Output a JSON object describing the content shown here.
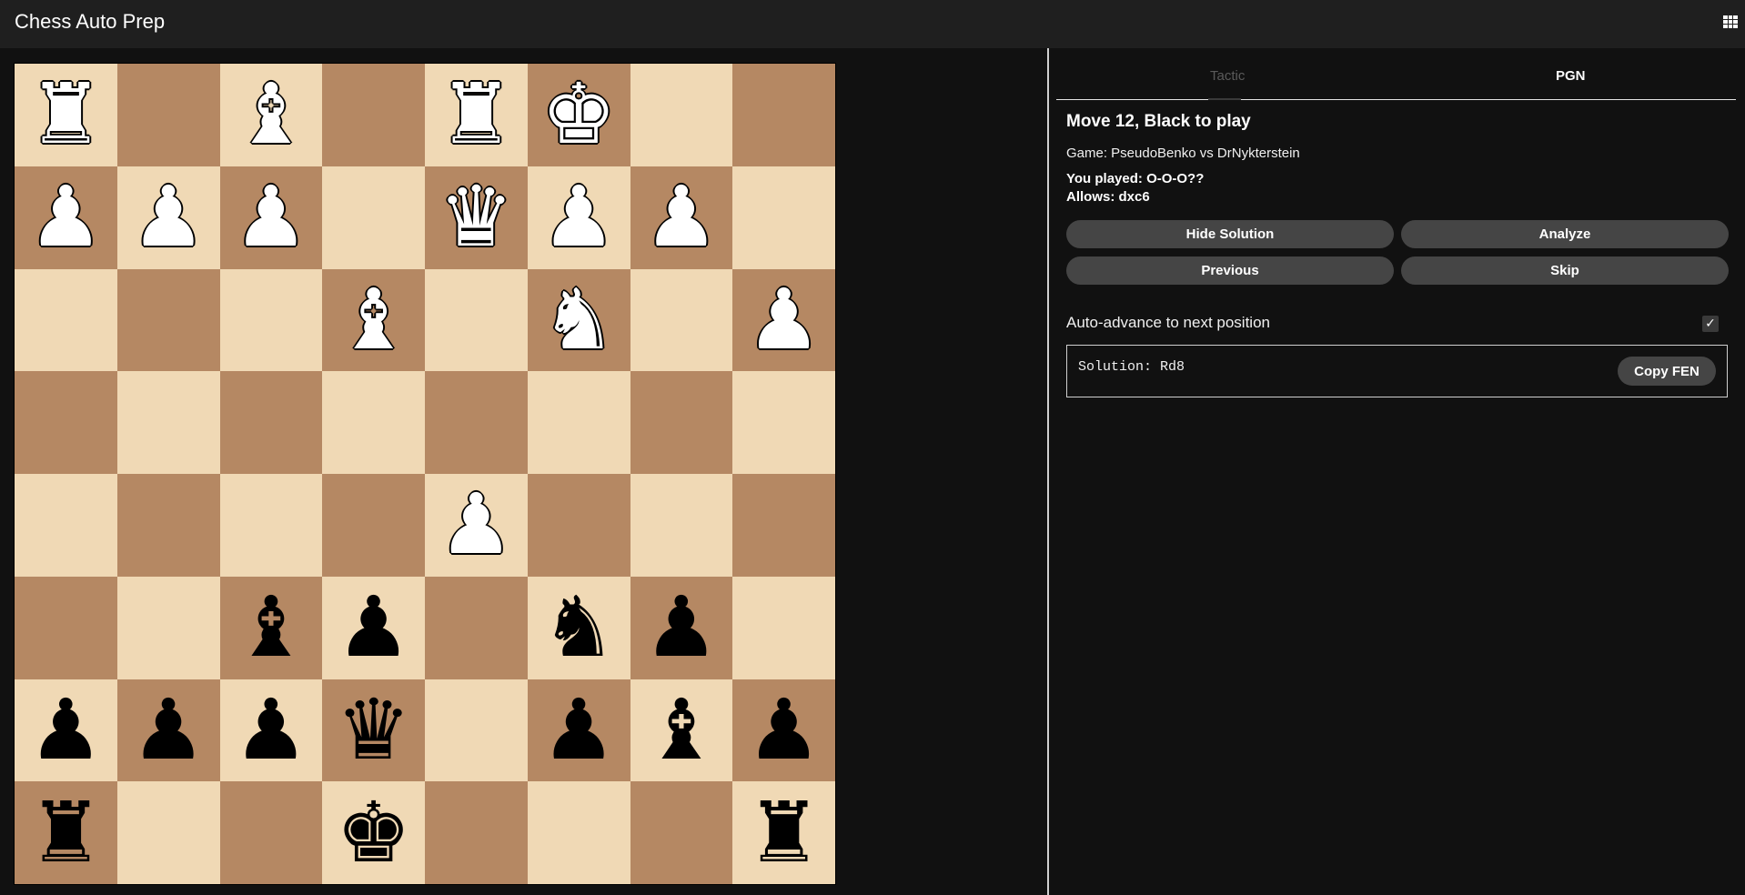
{
  "header": {
    "title": "Chess Auto Prep",
    "menu_icon": "grid-icon"
  },
  "board": {
    "light_color": "#f0d9b5",
    "dark_color": "#b58863",
    "rows": [
      [
        "♜",
        "",
        "♝",
        "",
        "♜",
        "♚",
        "",
        ""
      ],
      [
        "♟",
        "♟",
        "♟",
        "",
        "♛",
        "♟",
        "♟",
        ""
      ],
      [
        "",
        "",
        "",
        "♝",
        "",
        "♞",
        "",
        "♟"
      ],
      [
        "",
        "",
        "",
        "",
        "",
        "",
        "",
        ""
      ],
      [
        "",
        "",
        "",
        "",
        "♟",
        "",
        "",
        ""
      ],
      [
        "",
        "",
        "♝",
        "♟",
        "",
        "♞",
        "♟",
        ""
      ],
      [
        "♟",
        "♟",
        "♟",
        "♛",
        "",
        "♟",
        "♝",
        "♟"
      ],
      [
        "♜",
        "",
        "",
        "♚",
        "",
        "",
        "",
        "♜"
      ]
    ],
    "colors": [
      [
        "w",
        "",
        "w",
        "",
        "w",
        "w",
        "",
        ""
      ],
      [
        "w",
        "w",
        "w",
        "",
        "w",
        "w",
        "w",
        ""
      ],
      [
        "",
        "",
        "",
        "w",
        "",
        "w",
        "",
        "w"
      ],
      [
        "",
        "",
        "",
        "",
        "",
        "",
        "",
        ""
      ],
      [
        "",
        "",
        "",
        "",
        "w",
        "",
        "",
        ""
      ],
      [
        "",
        "",
        "b",
        "b",
        "",
        "b",
        "b",
        ""
      ],
      [
        "b",
        "b",
        "b",
        "b",
        "",
        "b",
        "b",
        "b"
      ],
      [
        "b",
        "",
        "",
        "b",
        "",
        "",
        "",
        "b"
      ]
    ]
  },
  "panel": {
    "tabs": [
      {
        "label": "Tactic",
        "active": false
      },
      {
        "label": "PGN",
        "active": true
      }
    ],
    "move_title": "Move 12, Black to play",
    "game": "Game: PseudoBenko vs DrNykterstein",
    "you_played": "You played: O-O-O??",
    "allows": "Allows: dxc6",
    "buttons": {
      "hide_solution": "Hide Solution",
      "analyze": "Analyze",
      "previous": "Previous",
      "skip": "Skip",
      "copy_fen": "Copy FEN"
    },
    "auto_advance_label": "Auto-advance to next position",
    "auto_advance_checked": true,
    "solution": "Solution: Rd8"
  }
}
